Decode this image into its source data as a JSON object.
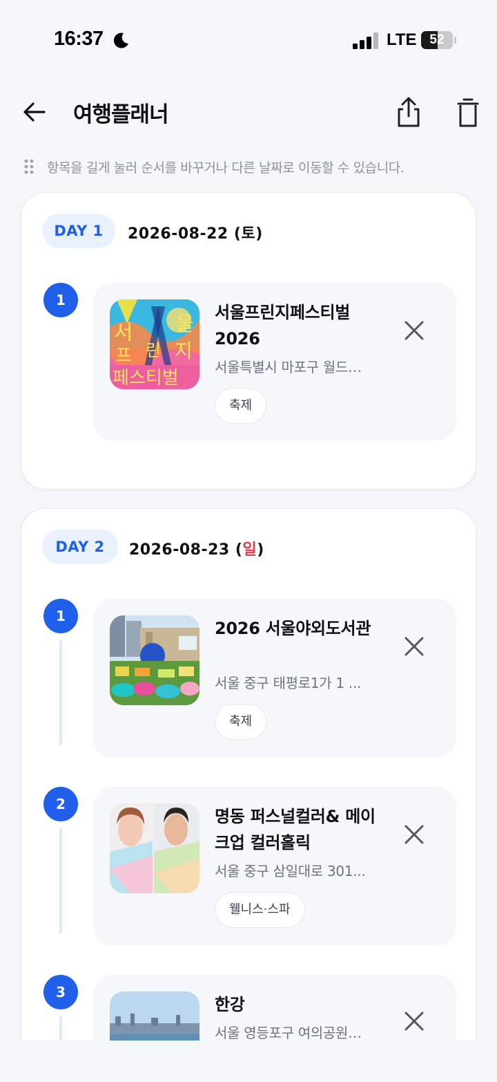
{
  "status_bar": {
    "time": "16:37",
    "network": "LTE",
    "battery_percent": "52",
    "battery_level": 0.52,
    "icons": [
      "moon-icon",
      "signal-icon",
      "battery-icon"
    ]
  },
  "header": {
    "title": "여행플래너",
    "icons": [
      "back-arrow-icon",
      "share-icon",
      "trash-icon"
    ]
  },
  "hint": {
    "text": "항목을 길게 눌러 순서를 바꾸거나 다른 날짜로 이동할 수 있습니다.",
    "icon": "drag-dots-icon"
  },
  "days": [
    {
      "badge": "DAY 1",
      "date_prefix": "2026-08-22 (",
      "weekday": "토",
      "date_suffix": ")",
      "items": [
        {
          "number": "1",
          "name": "서울프린지페스티벌 2026",
          "address": "서울특별시 마포구 월드…",
          "tag": "축제",
          "thumb_text": [
            "서",
            "울",
            "프",
            "린",
            "지",
            "페스티벌"
          ]
        }
      ]
    },
    {
      "badge": "DAY 2",
      "date_prefix": "2026-08-23 (",
      "weekday": "일",
      "date_suffix": ")",
      "items": [
        {
          "number": "1",
          "name": "2026 서울야외도서관",
          "address": "서울 중구 태평로1가 1 ...",
          "tag": "축제"
        },
        {
          "number": "2",
          "name": "명동 퍼스널컬러& 메이크업 컬러홀릭",
          "address": "서울 중구 삼일대로 301...",
          "tag": "웰니스·스파"
        },
        {
          "number": "3",
          "name": "한강",
          "address": "서울 영등포구 여의공원…",
          "tag": ""
        }
      ]
    }
  ],
  "colors": {
    "accent": "#1f5fe9",
    "badge_bg": "#e9f1fe",
    "sunday": "#e53945",
    "background": "#f4f6fa"
  }
}
